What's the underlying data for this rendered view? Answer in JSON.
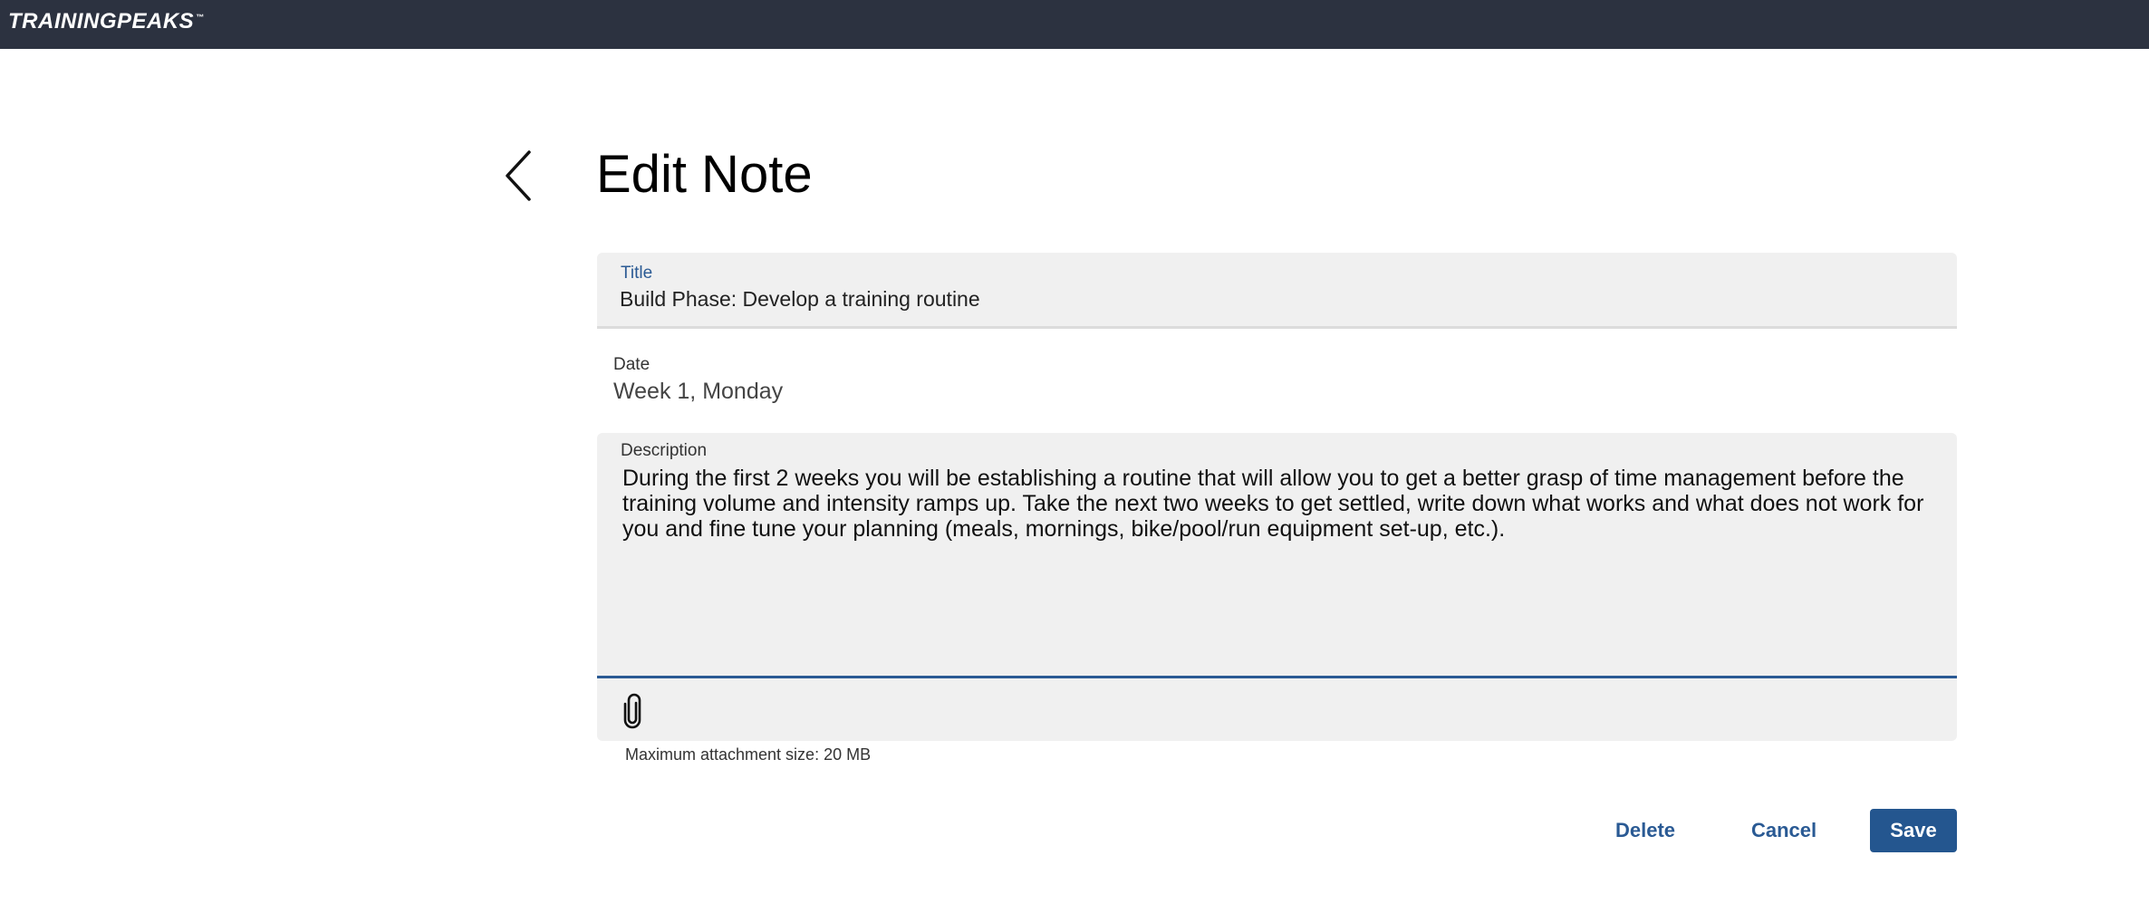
{
  "app": {
    "logo_text": "TRAININGPEAKS",
    "logo_mark": "™"
  },
  "page": {
    "title": "Edit Note",
    "back_icon": "chevron-left-icon"
  },
  "form": {
    "title_label": "Title",
    "title_value": "Build Phase: Develop a training routine",
    "date_label": "Date",
    "date_value": "Week 1, Monday",
    "description_label": "Description",
    "description_value": "During the first 2 weeks you will be establishing a routine that will allow you to get a better grasp of time management before the training volume and intensity ramps up. Take the next two weeks to get settled, write down what works and what does not work for you and fine tune your planning (meals, mornings, bike/pool/run equipment set-up, etc.).",
    "attach_icon": "paperclip-icon",
    "attachment_note": "Maximum attachment size: 20 MB"
  },
  "actions": {
    "delete_label": "Delete",
    "cancel_label": "Cancel",
    "save_label": "Save"
  },
  "colors": {
    "topbar": "#2c3240",
    "accent": "#24568f",
    "field_bg": "#f0f0f0"
  }
}
